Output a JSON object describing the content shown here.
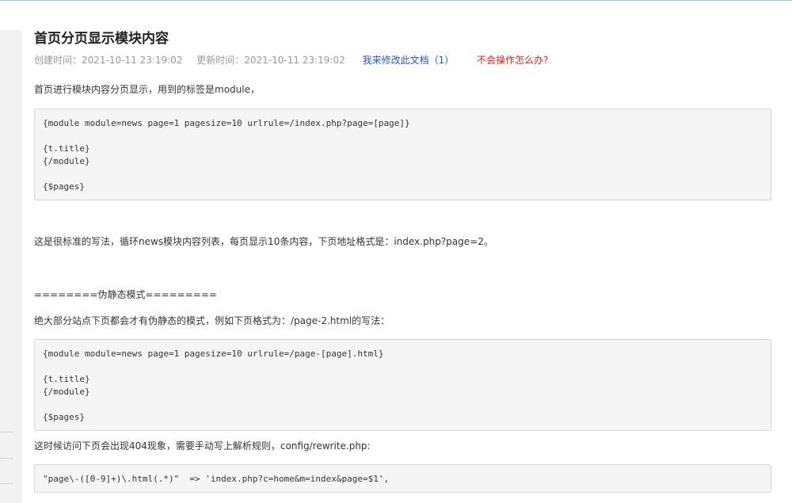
{
  "article": {
    "title": "首页分页显示模块内容",
    "created": "创建时间：2021-10-11 23:19:02",
    "updated": "更新时间：2021-10-11 23:19:02",
    "edit_link": "我来修改此文档（1）",
    "help_link": "不会操作怎么办?"
  },
  "body": {
    "p1": "首页进行模块内容分页显示，用到的标签是module，",
    "code1": [
      "{module module=news page=1 pagesize=10 urlrule=/index.php?page=[page]}",
      "",
      "{t.title}",
      "{/module}",
      "",
      "{$pages}"
    ],
    "p2": "这是很标准的写法，循环news模块内容列表，每页显示10条内容，下页地址格式是：index.php?page=2。",
    "p3": "========伪静态模式=========",
    "p4": "绝大部分站点下页都会才有伪静态的模式，例如下页格式为：/page-2.html的写法：",
    "code2": [
      "{module module=news page=1 pagesize=10 urlrule=/page-[page].html}",
      "",
      "{t.title}",
      "{/module}",
      "",
      "{$pages}"
    ],
    "p5": "这时候访问下页会出现404现象，需要手动写上解析规则，config/rewrite.php:",
    "code3": [
      "\"page\\-([0-9]+)\\.html(.*)\"  => 'index.php?c=home&m=index&page=$1',"
    ]
  }
}
